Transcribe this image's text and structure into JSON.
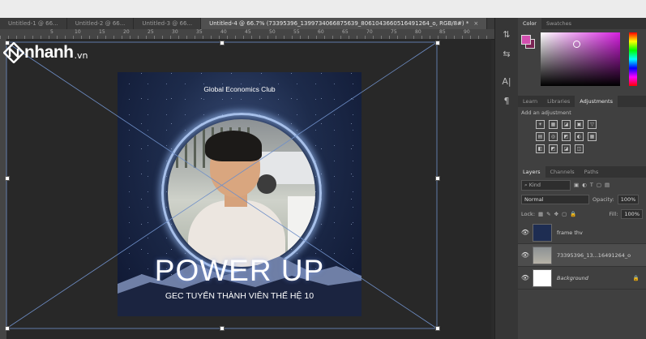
{
  "document_tabs": [
    {
      "label": "Untitled-1 @ 66...",
      "active": false
    },
    {
      "label": "Untitled-2 @ 66...",
      "active": false
    },
    {
      "label": "Untitled-3 @ 66...",
      "active": false
    },
    {
      "label": "Untitled-4 @ 66.7% (73395396_1399734066875639_8061043660516491264_o, RGB/8#) *",
      "active": true
    }
  ],
  "tab_close_glyph": "×",
  "ruler_numbers": [
    "5",
    "10",
    "15",
    "20",
    "25",
    "30",
    "35",
    "40",
    "45",
    "50",
    "55",
    "60",
    "65",
    "70",
    "75",
    "80",
    "85",
    "90"
  ],
  "watermark": {
    "brand": "nhanh",
    "suffix": ".vn",
    "color": "#ffffff"
  },
  "poster": {
    "club": "Global Economics Club",
    "headline": "POWER UP",
    "subline": "GEC TUYỂN THÀNH VIÊN THẾ HỆ 10"
  },
  "tool_icons": [
    "paragraph-move-icon",
    "character-panel-icon",
    "text-tool-icon",
    "paragraph-icon"
  ],
  "tool_glyphs": [
    "⇅",
    "⇆",
    "A|",
    "¶"
  ],
  "color_panel": {
    "tabs": [
      "Color",
      "Swatches"
    ],
    "foreground": "#d34faf",
    "background": "#7a2454"
  },
  "adjustments_panel": {
    "tabs": [
      "Learn",
      "Libraries",
      "Adjustments"
    ],
    "hint": "Add an adjustment",
    "row1": [
      "☀",
      "▦",
      "◪",
      "▣",
      "▽"
    ],
    "row2": [
      "▤",
      "◎",
      "◩",
      "◐",
      "▦"
    ],
    "row3": [
      "◧",
      "◩",
      "◪",
      "◫"
    ]
  },
  "layers_panel": {
    "tabs": [
      "Layers",
      "Channels",
      "Paths"
    ],
    "filter_label": "Kind",
    "blend_mode": "Normal",
    "opacity_label": "Opacity:",
    "opacity_value": "100%",
    "lock_label": "Lock:",
    "fill_label": "Fill:",
    "fill_value": "100%",
    "layers": [
      {
        "name": "frame thv",
        "visible": true,
        "selected": false,
        "thumb": "#1e2d52"
      },
      {
        "name": "73395396_13...16491264_o",
        "visible": true,
        "selected": true,
        "thumb": "#b7b3a7"
      },
      {
        "name": "Background",
        "visible": true,
        "selected": false,
        "thumb": "#ffffff",
        "locked": true
      }
    ]
  }
}
